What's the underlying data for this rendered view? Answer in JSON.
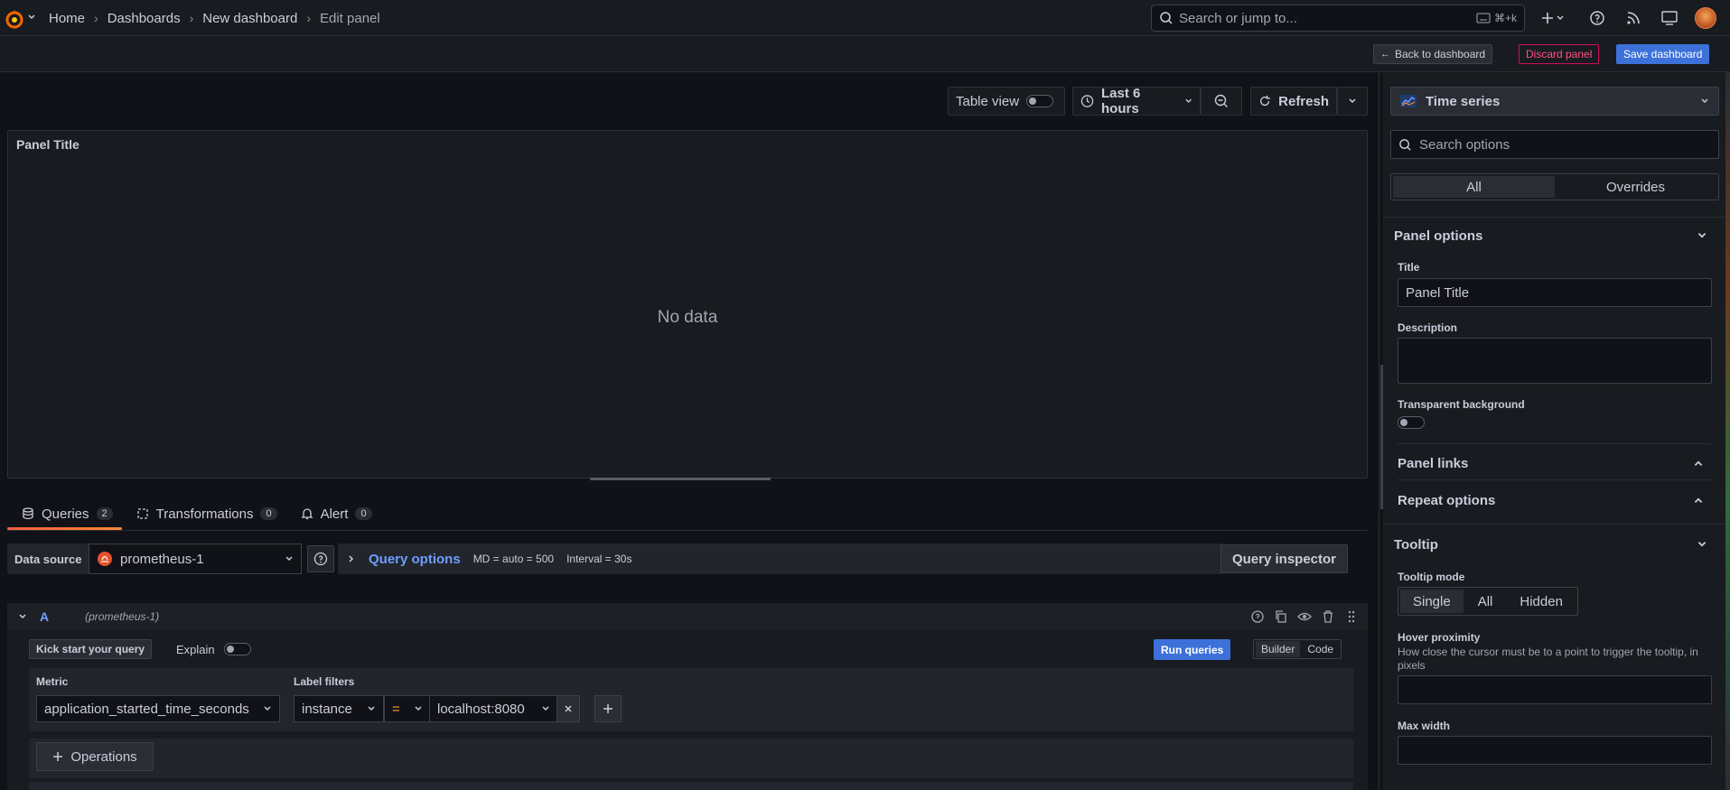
{
  "breadcrumbs": [
    "Home",
    "Dashboards",
    "New dashboard",
    "Edit panel"
  ],
  "search": {
    "placeholder": "Search or jump to...",
    "shortcut": "⌘+k"
  },
  "actions": {
    "back": "Back to dashboard",
    "discard": "Discard panel",
    "save": "Save dashboard"
  },
  "toolbar": {
    "table_view": "Table view",
    "time_range": "Last 6 hours",
    "refresh": "Refresh"
  },
  "panel": {
    "title": "Panel Title",
    "nodata": "No data"
  },
  "tabs": [
    {
      "label": "Queries",
      "count": "2"
    },
    {
      "label": "Transformations",
      "count": "0"
    },
    {
      "label": "Alert",
      "count": "0"
    }
  ],
  "datasource": {
    "label": "Data source",
    "value": "prometheus-1"
  },
  "query_options": {
    "label": "Query options",
    "md": "MD = auto = 500",
    "interval": "Interval = 30s",
    "inspector": "Query inspector"
  },
  "query": {
    "letter": "A",
    "ds": "(prometheus-1)",
    "kick": "Kick start your query",
    "explain": "Explain",
    "run": "Run queries",
    "modes": [
      "Builder",
      "Code"
    ],
    "metric_label": "Metric",
    "metric_value": "application_started_time_seconds",
    "label_filters_label": "Label filters",
    "filter_label": "instance",
    "filter_op": "=",
    "filter_value": "localhost:8080",
    "operations": "Operations"
  },
  "options": {
    "viz": "Time series",
    "search_placeholder": "Search options",
    "seg": [
      "All",
      "Overrides"
    ],
    "panel_options": "Panel options",
    "title_label": "Title",
    "title_value": "Panel Title",
    "description_label": "Description",
    "transparent_label": "Transparent background",
    "panel_links": "Panel links",
    "repeat_options": "Repeat options",
    "tooltip": "Tooltip",
    "tooltip_mode_label": "Tooltip mode",
    "tooltip_modes": [
      "Single",
      "All",
      "Hidden"
    ],
    "hover_label": "Hover proximity",
    "hover_desc": "How close the cursor must be to a point to trigger the tooltip, in pixels",
    "max_width_label": "Max width"
  },
  "colors": {
    "accent": "#3d71d9",
    "danger": "#ff5286",
    "link": "#6e9fff",
    "tab_underline": "#ff8833"
  }
}
